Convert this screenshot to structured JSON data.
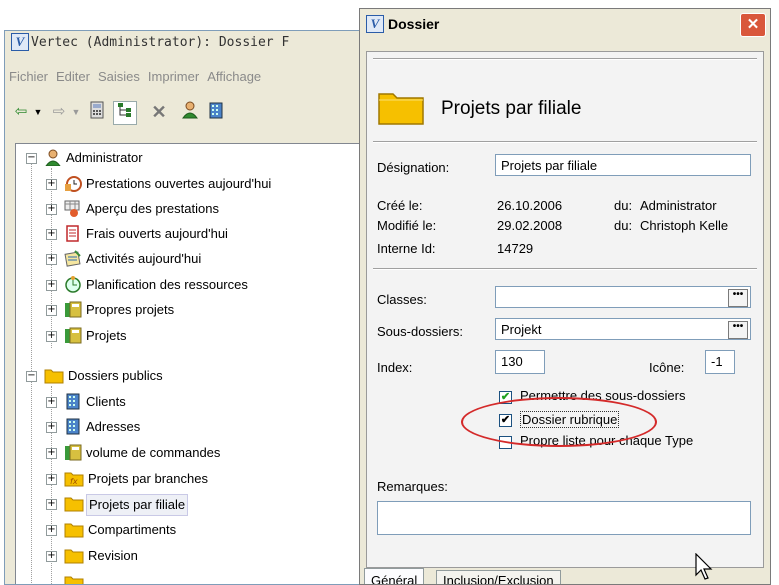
{
  "main_window": {
    "title": "Vertec (Administrator): Dossier F",
    "menu": [
      "Fichier",
      "Editer",
      "Saisies",
      "Imprimer",
      "Affichage"
    ],
    "toolbar_icons": [
      "back-arrow-icon",
      "dropdown-arrow-icon",
      "forward-arrow-icon",
      "dropdown-arrow-icon",
      "calculator-icon",
      "tree-view-icon",
      "delete-icon",
      "user-icon",
      "building-icon"
    ]
  },
  "tree": {
    "nodes": [
      {
        "label": "Administrator",
        "icon": "user-icon",
        "level": 0,
        "expander": "−"
      },
      {
        "label": "Prestations ouvertes aujourd'hui",
        "icon": "clock-icon",
        "level": 1,
        "expander": "+"
      },
      {
        "label": "Aperçu des prestations",
        "icon": "table-icon",
        "level": 1,
        "expander": "+"
      },
      {
        "label": "Frais ouverts aujourd'hui",
        "icon": "receipt-icon",
        "level": 1,
        "expander": "+"
      },
      {
        "label": "Activités aujourd'hui",
        "icon": "notepad-icon",
        "level": 1,
        "expander": "+"
      },
      {
        "label": "Planification des ressources",
        "icon": "planning-icon",
        "level": 1,
        "expander": "+"
      },
      {
        "label": "Propres projets",
        "icon": "project-icon",
        "level": 1,
        "expander": "+"
      },
      {
        "label": "Projets",
        "icon": "project-icon",
        "level": 1,
        "expander": "+"
      },
      {
        "label": "Dossiers publics",
        "icon": "folder-icon",
        "level": 0,
        "expander": "−"
      },
      {
        "label": "Clients",
        "icon": "building-icon",
        "level": 1,
        "expander": "+"
      },
      {
        "label": "Adresses",
        "icon": "building-icon",
        "level": 1,
        "expander": "+"
      },
      {
        "label": "volume de commandes",
        "icon": "project-icon",
        "level": 1,
        "expander": "+"
      },
      {
        "label": "Projets par branches",
        "icon": "folder-expression-icon",
        "level": 1,
        "expander": "+"
      },
      {
        "label": "Projets par filiale",
        "icon": "folder-icon",
        "level": 1,
        "expander": "+",
        "selected": true
      },
      {
        "label": "Compartiments",
        "icon": "folder-icon",
        "level": 1,
        "expander": "+"
      },
      {
        "label": "Revision",
        "icon": "folder-icon",
        "level": 1,
        "expander": "+"
      }
    ]
  },
  "dialog": {
    "title": "Dossier",
    "close_label": "✕",
    "header_title": "Projets par filiale",
    "designation_label": "Désignation:",
    "designation_value": "Projets par filiale",
    "cree_label": "Créé le:",
    "cree_date": "26.10.2006",
    "cree_du_label": "du:",
    "cree_by": "Administrator",
    "modifie_label": "Modifié le:",
    "modifie_date": "29.02.2008",
    "modifie_du_label": "du:",
    "modifie_by": "Christoph Kelle",
    "interne_label": "Interne Id:",
    "interne_value": "14729",
    "classes_label": "Classes:",
    "classes_value": "",
    "sous_dossiers_label": "Sous-dossiers:",
    "sous_dossiers_value": "Projekt",
    "ellipsis": "•••",
    "index_label": "Index:",
    "index_value": "130",
    "icone_label": "Icône:",
    "icone_value": "-1",
    "check_permettre_label": "Permettre des sous-dossiers",
    "check_permettre": true,
    "check_rubrique_label": "Dossier rubrique",
    "check_rubrique": true,
    "check_propre_label": "Propre liste pour chaque Type",
    "check_propre": false,
    "remarques_label": "Remarques:",
    "remarques_value": "",
    "tabs": [
      "Général",
      "Inclusion/Exclusion"
    ],
    "active_tab": "Général"
  },
  "annotation_color": "#d42a2a"
}
